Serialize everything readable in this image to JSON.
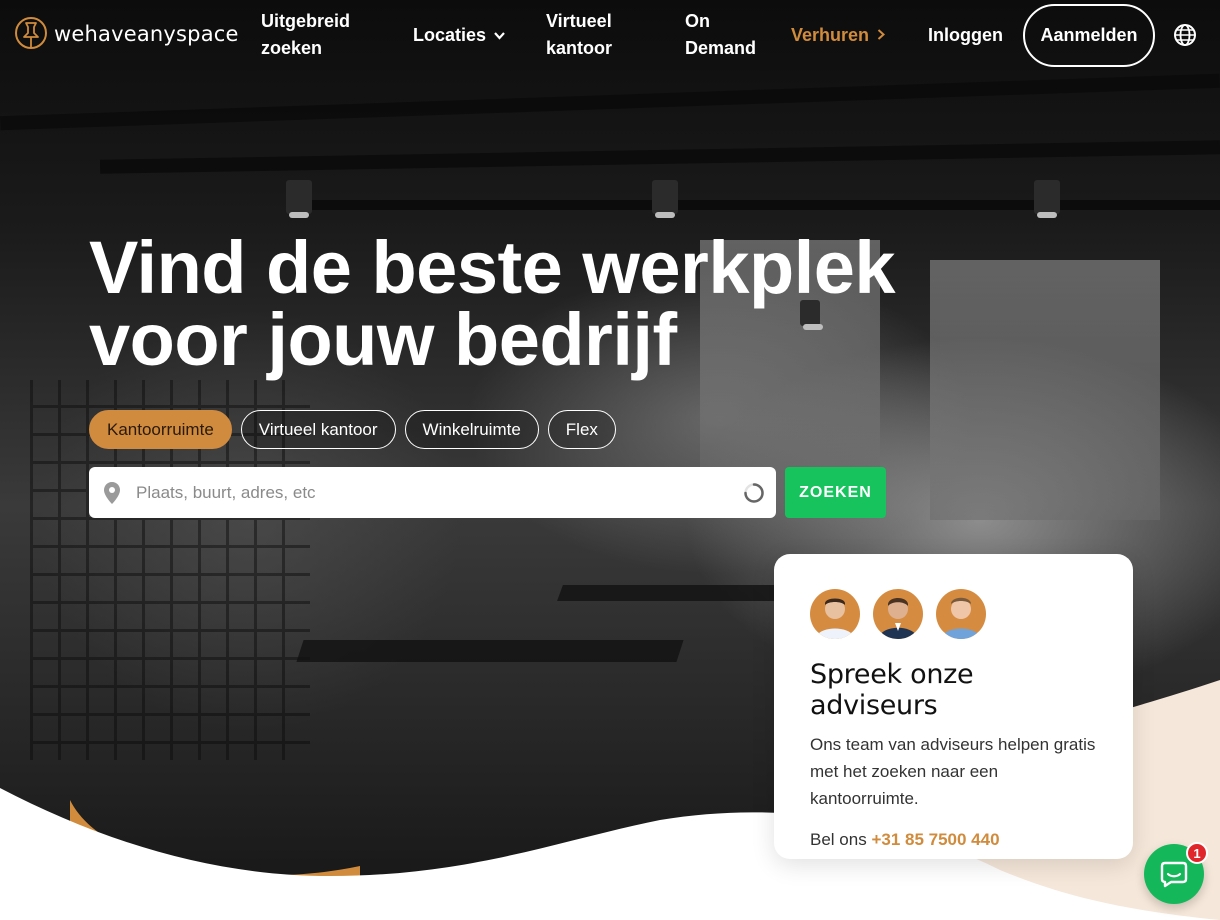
{
  "brand": {
    "name": "wehaveanyspace"
  },
  "nav": {
    "advanced_search": "Uitgebreid\nzoeken",
    "locations": "Locaties",
    "virtual_office": "Virtueel\nkantoor",
    "on_demand": "On\nDemand",
    "rent_out": "Verhuren",
    "login": "Inloggen",
    "signup": "Aanmelden"
  },
  "hero": {
    "headline_line1": "Vind de beste werkplek",
    "headline_line2": "voor jouw bedrijf",
    "categories": [
      "Kantoorruimte",
      "Virtueel kantoor",
      "Winkelruimte",
      "Flex"
    ],
    "active_category": "Kantoorruimte",
    "search_placeholder": "Plaats, buurt, adres, etc",
    "search_button": "ZOEKEN"
  },
  "advisor_card": {
    "title": "Spreek onze adviseurs",
    "text": "Ons team van adviseurs helpen gratis met het zoeken naar een kantoorruimte.",
    "call_prefix": "Bel ons",
    "phone": "+31 85 7500 440"
  },
  "chat": {
    "badge_count": "1"
  },
  "colors": {
    "accent": "#d08b3c",
    "green": "#17c35c",
    "badge_red": "#e0262b"
  },
  "icons": [
    "logo-pin-icon",
    "chevron-down-icon",
    "chevron-right-icon",
    "globe-icon",
    "map-pin-icon",
    "spinner-icon",
    "chat-icon"
  ]
}
